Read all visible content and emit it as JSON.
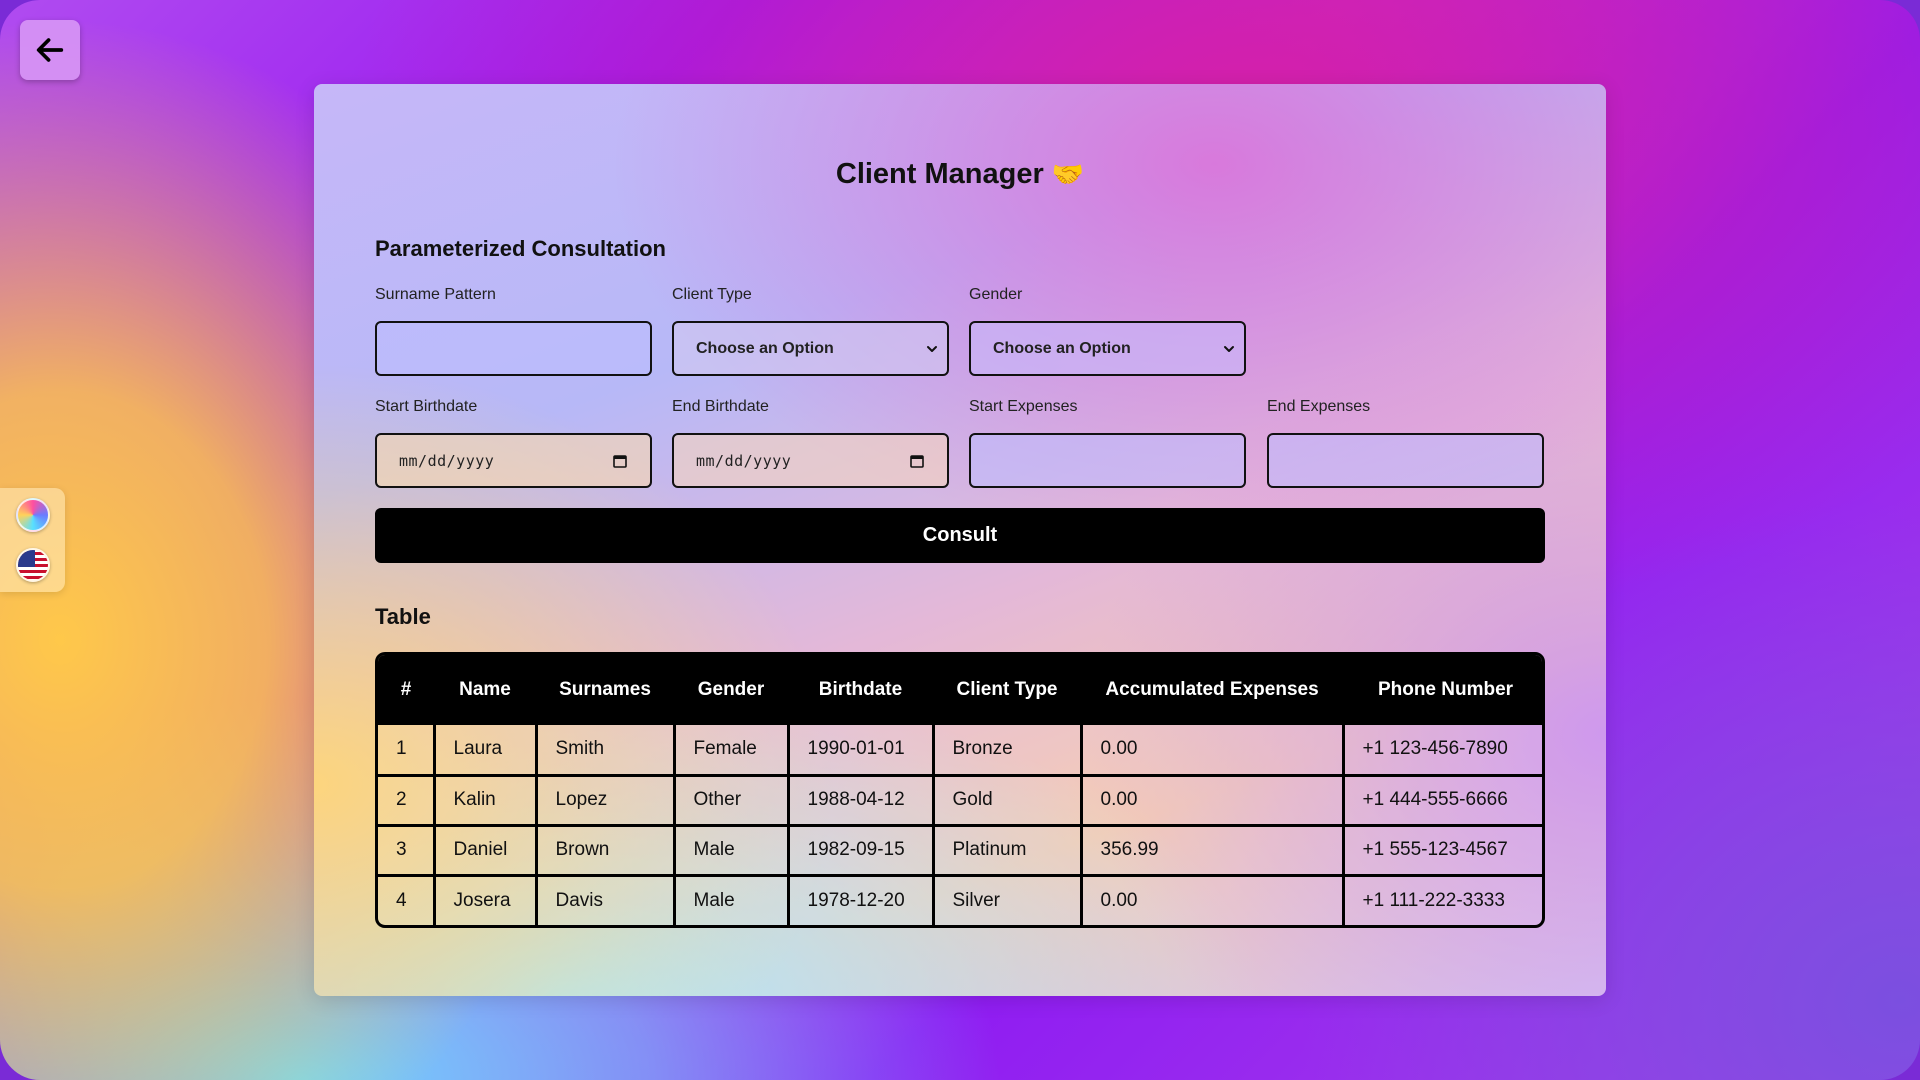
{
  "app": {
    "title": "Client Manager",
    "title_emoji": "🤝"
  },
  "form": {
    "section_title": "Parameterized Consultation",
    "surname_label": "Surname Pattern",
    "surname_value": "",
    "client_type_label": "Client Type",
    "client_type_selected": "Choose an Option",
    "gender_label": "Gender",
    "gender_selected": "Choose an Option",
    "start_birthdate_label": "Start Birthdate",
    "start_birthdate_placeholder": "mm/dd/yyyy",
    "end_birthdate_label": "End Birthdate",
    "end_birthdate_placeholder": "mm/dd/yyyy",
    "start_expenses_label": "Start Expenses",
    "start_expenses_value": "",
    "end_expenses_label": "End Expenses",
    "end_expenses_value": "",
    "consult_label": "Consult"
  },
  "table": {
    "section_title": "Table",
    "headers": [
      "#",
      "Name",
      "Surnames",
      "Gender",
      "Birthdate",
      "Client Type",
      "Accumulated Expenses",
      "Phone Number"
    ],
    "rows": [
      [
        "1",
        "Laura",
        "Smith",
        "Female",
        "1990-01-01",
        "Bronze",
        "0.00",
        "+1 123-456-7890"
      ],
      [
        "2",
        "Kalin",
        "Lopez",
        "Other",
        "1988-04-12",
        "Gold",
        "0.00",
        "+1 444-555-6666"
      ],
      [
        "3",
        "Daniel",
        "Brown",
        "Male",
        "1982-09-15",
        "Platinum",
        "356.99",
        "+1 555-123-4567"
      ],
      [
        "4",
        "Josera",
        "Davis",
        "Male",
        "1978-12-20",
        "Silver",
        "0.00",
        "+1 111-222-3333"
      ]
    ]
  },
  "nav": {
    "back_icon": "arrow-left-icon",
    "theme_icon": "theme-palette-icon",
    "language_icon": "us-flag-icon"
  }
}
